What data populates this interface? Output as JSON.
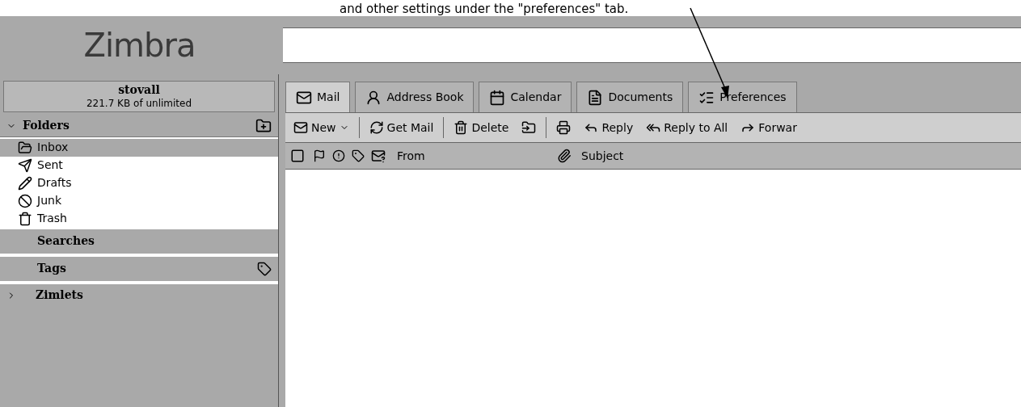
{
  "caption": "and other settings under the \"preferences\" tab.",
  "logo": "Zimbra",
  "account": {
    "name": "stovall",
    "quota": "221.7 KB of unlimited"
  },
  "folders": {
    "label": "Folders",
    "expanded": true,
    "items": [
      {
        "label": "Inbox",
        "selected": true
      },
      {
        "label": "Sent",
        "selected": false
      },
      {
        "label": "Drafts",
        "selected": false
      },
      {
        "label": "Junk",
        "selected": false
      },
      {
        "label": "Trash",
        "selected": false
      }
    ]
  },
  "searches": {
    "label": "Searches"
  },
  "tags": {
    "label": "Tags"
  },
  "zimlets": {
    "label": "Zimlets",
    "expanded": false
  },
  "tabs": [
    {
      "label": "Mail",
      "selected": true
    },
    {
      "label": "Address Book",
      "selected": false
    },
    {
      "label": "Calendar",
      "selected": false
    },
    {
      "label": "Documents",
      "selected": false
    },
    {
      "label": "Preferences",
      "selected": false
    }
  ],
  "toolbar": [
    {
      "label": "New",
      "dropdown": true
    },
    {
      "label": "Get Mail",
      "dropdown": false
    },
    {
      "label": "Delete",
      "dropdown": false
    },
    {
      "dropdown": false
    },
    {
      "dropdown": false
    },
    {
      "label": "Reply",
      "dropdown": false
    },
    {
      "label": "Reply to All",
      "dropdown": false
    },
    {
      "label": "Forwar",
      "dropdown": false
    }
  ],
  "columns": {
    "from": "From",
    "subject": "Subject"
  }
}
